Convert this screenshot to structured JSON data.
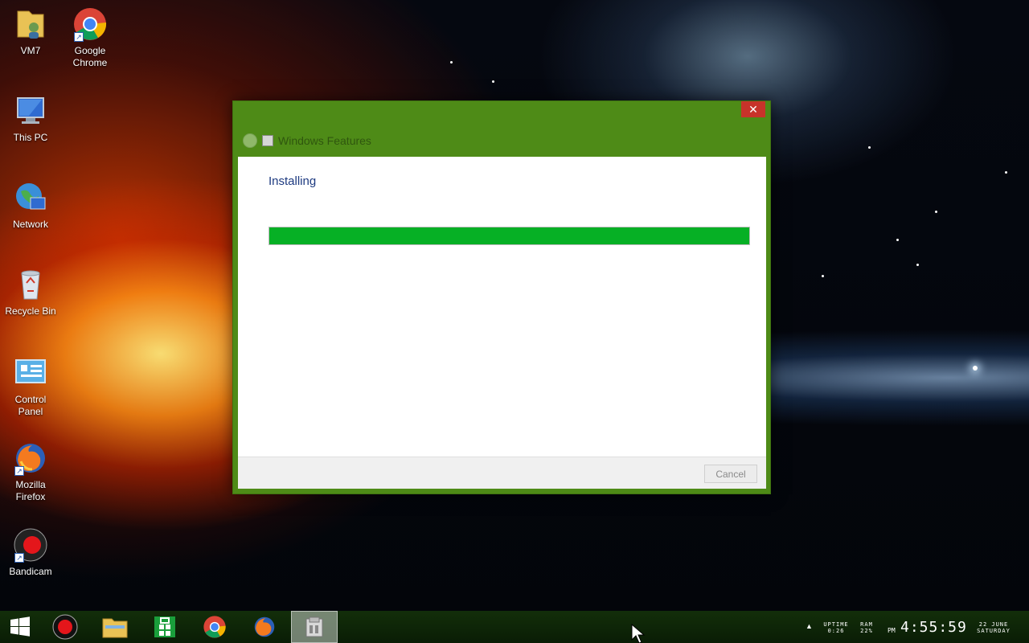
{
  "desktop": {
    "icons": [
      {
        "label": "VM7",
        "icon": "user-folder-icon"
      },
      {
        "label": "Google Chrome",
        "icon": "chrome-icon"
      },
      {
        "label": "This PC",
        "icon": "computer-icon"
      },
      {
        "label": "Network",
        "icon": "network-globe-icon"
      },
      {
        "label": "Recycle Bin",
        "icon": "recycle-bin-icon"
      },
      {
        "label": "Control Panel",
        "icon": "control-panel-icon"
      },
      {
        "label": "Mozilla Firefox",
        "icon": "firefox-icon"
      },
      {
        "label": "Bandicam",
        "icon": "bandicam-icon"
      }
    ]
  },
  "dialog": {
    "title": "Windows Features",
    "close_glyph": "✕",
    "heading": "Installing",
    "progress": 1.0,
    "cancel_label": "Cancel",
    "accent_color": "#4e8b17",
    "progress_color": "#06b025"
  },
  "taskbar": {
    "buttons": [
      {
        "name": "start",
        "icon": "windows-logo-icon"
      },
      {
        "name": "bandicam",
        "icon": "record-icon"
      },
      {
        "name": "file-explorer",
        "icon": "folder-icon"
      },
      {
        "name": "store",
        "icon": "store-icon"
      },
      {
        "name": "chrome",
        "icon": "chrome-icon"
      },
      {
        "name": "firefox",
        "icon": "firefox-icon"
      },
      {
        "name": "windows-features",
        "icon": "windows-features-icon"
      }
    ],
    "tray": {
      "uptime_label": "UPTIME",
      "uptime_value": "0:26",
      "ram_label": "RAM",
      "ram_value": "22%",
      "ampm": "PM",
      "time": "4:55:59",
      "date": "22 JUNE",
      "day": "SATURDAY"
    }
  }
}
